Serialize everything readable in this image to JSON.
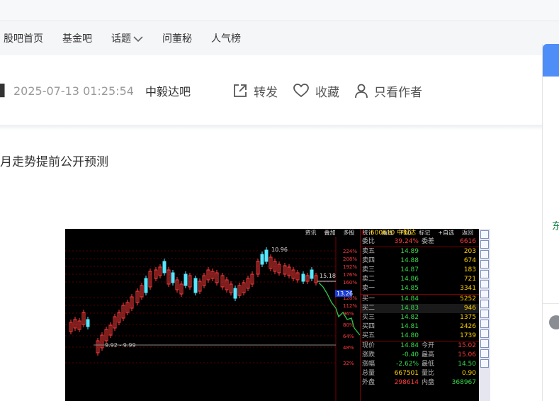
{
  "nav": {
    "items": [
      {
        "label": "股吧首页"
      },
      {
        "label": "基金吧"
      },
      {
        "label": "话题"
      },
      {
        "label": "问董秘"
      },
      {
        "label": "人气榜"
      }
    ]
  },
  "meta": {
    "date": "2025-07-13 01:25:54",
    "bar_name": "中毅达吧",
    "actions": {
      "share": "转发",
      "favorite": "收藏",
      "author_only": "只看作者"
    }
  },
  "post": {
    "title": "月走势提前公开预测"
  },
  "stock": {
    "toolbar": [
      "资讯",
      "叠加",
      "多股",
      "统计",
      "画线",
      "F10",
      "标记",
      "+自选",
      "返回"
    ],
    "code": "600610",
    "name": "中毅达",
    "price_labels": {
      "high": "10.96",
      "marker": "15.18",
      "current_tag": "13.26",
      "range": "9.92 - 9.99"
    },
    "pct_ticks": [
      "224%",
      "208%",
      "192%",
      "176%",
      "160%",
      "128%",
      "112%",
      "96%",
      "80%",
      "64%",
      "48%",
      "32%"
    ],
    "ratio": {
      "label": "委比",
      "value": "39.24%",
      "label2": "委差",
      "value2": "6616"
    },
    "asks": [
      {
        "label": "卖五",
        "price": "14.89",
        "vol": "203"
      },
      {
        "label": "卖四",
        "price": "14.88",
        "vol": "674"
      },
      {
        "label": "卖三",
        "price": "14.87",
        "vol": "183"
      },
      {
        "label": "卖二",
        "price": "14.86",
        "vol": "721"
      },
      {
        "label": "卖一",
        "price": "14.85",
        "vol": "3341"
      }
    ],
    "bids": [
      {
        "label": "买一",
        "price": "14.84",
        "vol": "5252"
      },
      {
        "label": "买二",
        "price": "14.83",
        "vol": "946"
      },
      {
        "label": "买三",
        "price": "14.82",
        "vol": "1375"
      },
      {
        "label": "买四",
        "price": "14.81",
        "vol": "2426"
      },
      {
        "label": "买五",
        "price": "14.80",
        "vol": "1739"
      }
    ],
    "stats": [
      {
        "label": "现价",
        "value": "14.84",
        "label2": "今开",
        "value2": "15.02"
      },
      {
        "label": "涨跌",
        "value": "-0.40",
        "label2": "最高",
        "value2": "15.06"
      },
      {
        "label": "涨幅",
        "value": "-2.62%",
        "label2": "最低",
        "value2": "14.50"
      },
      {
        "label": "总量",
        "value": "667501",
        "label2": "量比",
        "value2": "0.90"
      },
      {
        "label": "外盘",
        "value": "298614",
        "label2": "内盘",
        "value2": "368967"
      }
    ]
  },
  "right_panel": {
    "text": "东"
  },
  "colors": {
    "accent_blue": "#4f8ef7",
    "up_red": "#ff3b3b",
    "down_green": "#35d84a",
    "quote_yellow": "#ffd000"
  }
}
